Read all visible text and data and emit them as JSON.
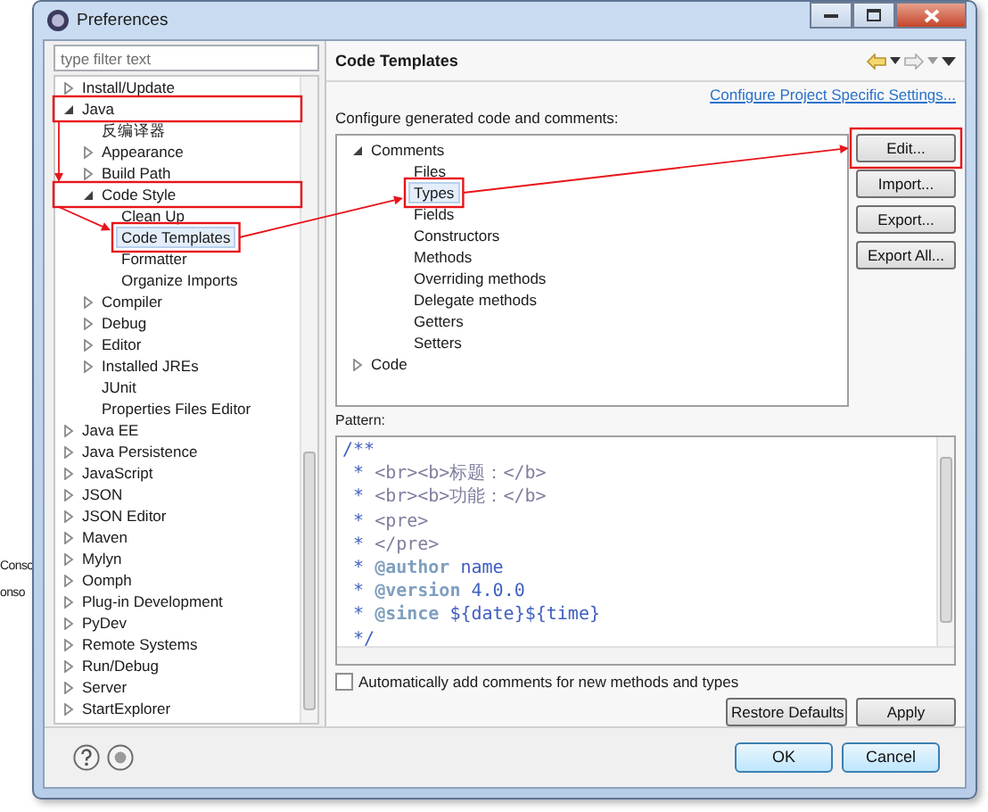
{
  "background_texts": [
    "Conso",
    "onso"
  ],
  "window": {
    "title": "Preferences"
  },
  "filter": {
    "placeholder": "type filter text"
  },
  "nav_tree": [
    {
      "label": "Install/Update",
      "expanded": false,
      "selected": false
    },
    {
      "label": "Java",
      "expanded": true,
      "selected": false,
      "children": [
        {
          "label": "反编译器",
          "selected": false
        },
        {
          "label": "Appearance",
          "expanded": false,
          "selected": false
        },
        {
          "label": "Build Path",
          "expanded": false,
          "selected": false
        },
        {
          "label": "Code Style",
          "expanded": true,
          "selected": false,
          "children": [
            {
              "label": "Clean Up",
              "selected": false
            },
            {
              "label": "Code Templates",
              "selected": true
            },
            {
              "label": "Formatter",
              "selected": false
            },
            {
              "label": "Organize Imports",
              "selected": false
            }
          ]
        },
        {
          "label": "Compiler",
          "expanded": false,
          "selected": false
        },
        {
          "label": "Debug",
          "expanded": false,
          "selected": false
        },
        {
          "label": "Editor",
          "expanded": false,
          "selected": false
        },
        {
          "label": "Installed JREs",
          "expanded": false,
          "selected": false
        },
        {
          "label": "JUnit",
          "selected": false
        },
        {
          "label": "Properties Files Editor",
          "selected": false
        }
      ]
    },
    {
      "label": "Java EE",
      "expanded": false,
      "selected": false
    },
    {
      "label": "Java Persistence",
      "expanded": false,
      "selected": false
    },
    {
      "label": "JavaScript",
      "expanded": false,
      "selected": false
    },
    {
      "label": "JSON",
      "expanded": false,
      "selected": false
    },
    {
      "label": "JSON Editor",
      "expanded": false,
      "selected": false
    },
    {
      "label": "Maven",
      "expanded": false,
      "selected": false
    },
    {
      "label": "Mylyn",
      "expanded": false,
      "selected": false
    },
    {
      "label": "Oomph",
      "expanded": false,
      "selected": false
    },
    {
      "label": "Plug-in Development",
      "expanded": false,
      "selected": false
    },
    {
      "label": "PyDev",
      "expanded": false,
      "selected": false
    },
    {
      "label": "Remote Systems",
      "expanded": false,
      "selected": false
    },
    {
      "label": "Run/Debug",
      "expanded": false,
      "selected": false
    },
    {
      "label": "Server",
      "expanded": false,
      "selected": false
    },
    {
      "label": "StartExplorer",
      "expanded": false,
      "selected": false
    }
  ],
  "page": {
    "title": "Code Templates",
    "link": "Configure Project Specific Settings...",
    "tree_label": "Configure generated code and comments:",
    "template_tree": [
      {
        "label": "Comments",
        "expanded": true,
        "selected": false,
        "children": [
          {
            "label": "Files",
            "selected": false
          },
          {
            "label": "Types",
            "selected": true
          },
          {
            "label": "Fields",
            "selected": false
          },
          {
            "label": "Constructors",
            "selected": false
          },
          {
            "label": "Methods",
            "selected": false
          },
          {
            "label": "Overriding methods",
            "selected": false
          },
          {
            "label": "Delegate methods",
            "selected": false
          },
          {
            "label": "Getters",
            "selected": false
          },
          {
            "label": "Setters",
            "selected": false
          }
        ]
      },
      {
        "label": "Code",
        "expanded": false,
        "selected": false
      }
    ],
    "side_buttons": [
      "Edit...",
      "Import...",
      "Export...",
      "Export All..."
    ],
    "pattern_label": "Pattern:",
    "pattern_lines": [
      [
        {
          "kind": "comment",
          "text": "/**"
        }
      ],
      [
        {
          "kind": "comment",
          "text": " * "
        },
        {
          "kind": "html",
          "text": "<br><b>标题：</b>"
        }
      ],
      [
        {
          "kind": "comment",
          "text": " * "
        },
        {
          "kind": "html",
          "text": "<br><b>功能：</b>"
        }
      ],
      [
        {
          "kind": "comment",
          "text": " * "
        },
        {
          "kind": "html",
          "text": "<pre>"
        }
      ],
      [
        {
          "kind": "comment",
          "text": " * "
        },
        {
          "kind": "html",
          "text": "</pre>"
        }
      ],
      [
        {
          "kind": "comment",
          "text": " * "
        },
        {
          "kind": "tag",
          "text": "@author"
        },
        {
          "kind": "comment",
          "text": " name"
        }
      ],
      [
        {
          "kind": "comment",
          "text": " * "
        },
        {
          "kind": "tag",
          "text": "@version"
        },
        {
          "kind": "comment",
          "text": " 4.0.0"
        }
      ],
      [
        {
          "kind": "comment",
          "text": " * "
        },
        {
          "kind": "tag",
          "text": "@since"
        },
        {
          "kind": "comment",
          "text": " ${date}${time}"
        }
      ],
      [
        {
          "kind": "comment",
          "text": " */"
        }
      ]
    ],
    "auto_comments": {
      "label": "Automatically add comments for new methods and types",
      "checked": false
    },
    "page_buttons": [
      "Restore Defaults",
      "Apply"
    ]
  },
  "dialog_buttons": [
    "OK",
    "Cancel"
  ]
}
